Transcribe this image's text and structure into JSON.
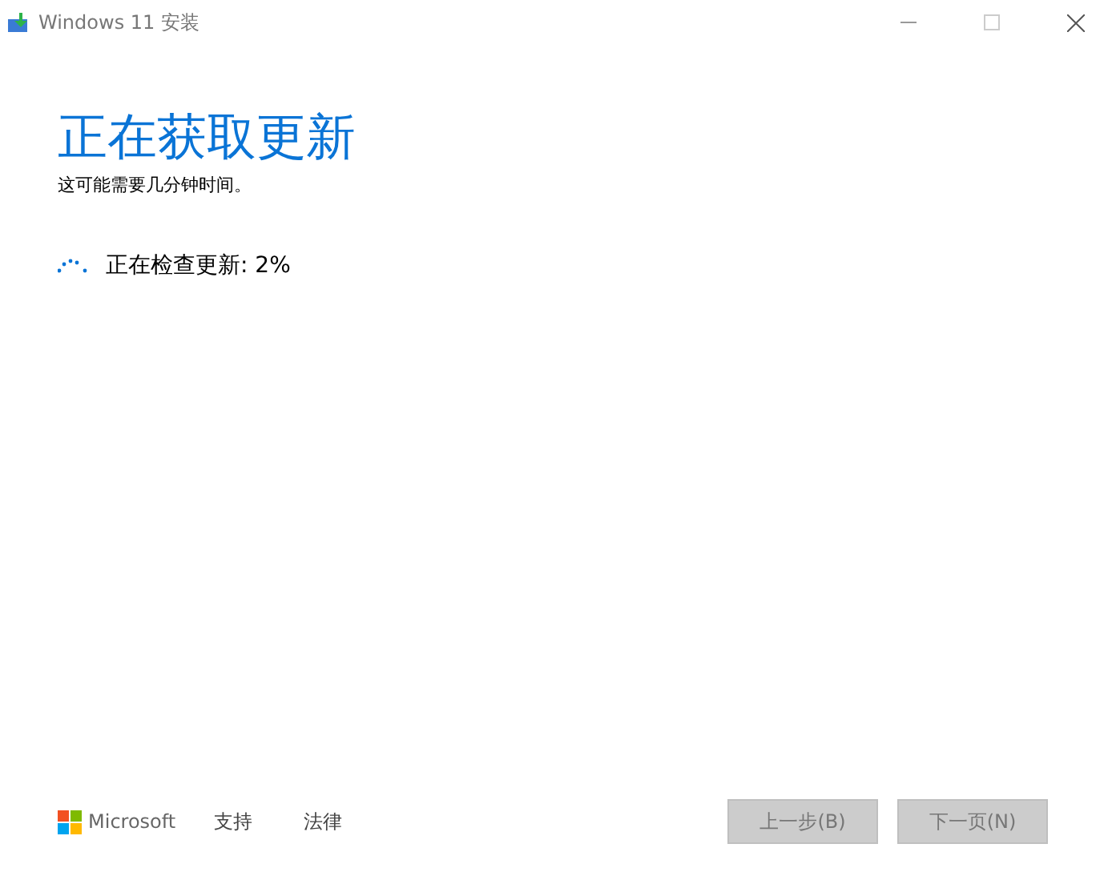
{
  "window": {
    "title": "Windows 11 安装"
  },
  "heading": "正在获取更新",
  "subtitle": "这可能需要几分钟时间。",
  "progress": {
    "text": "正在检查更新: 2%"
  },
  "footer": {
    "brand": "Microsoft",
    "links": [
      "支持",
      "法律"
    ],
    "buttons": [
      {
        "label": "上一步(B)",
        "disabled": true
      },
      {
        "label": "下一页(N)",
        "disabled": true
      }
    ]
  }
}
